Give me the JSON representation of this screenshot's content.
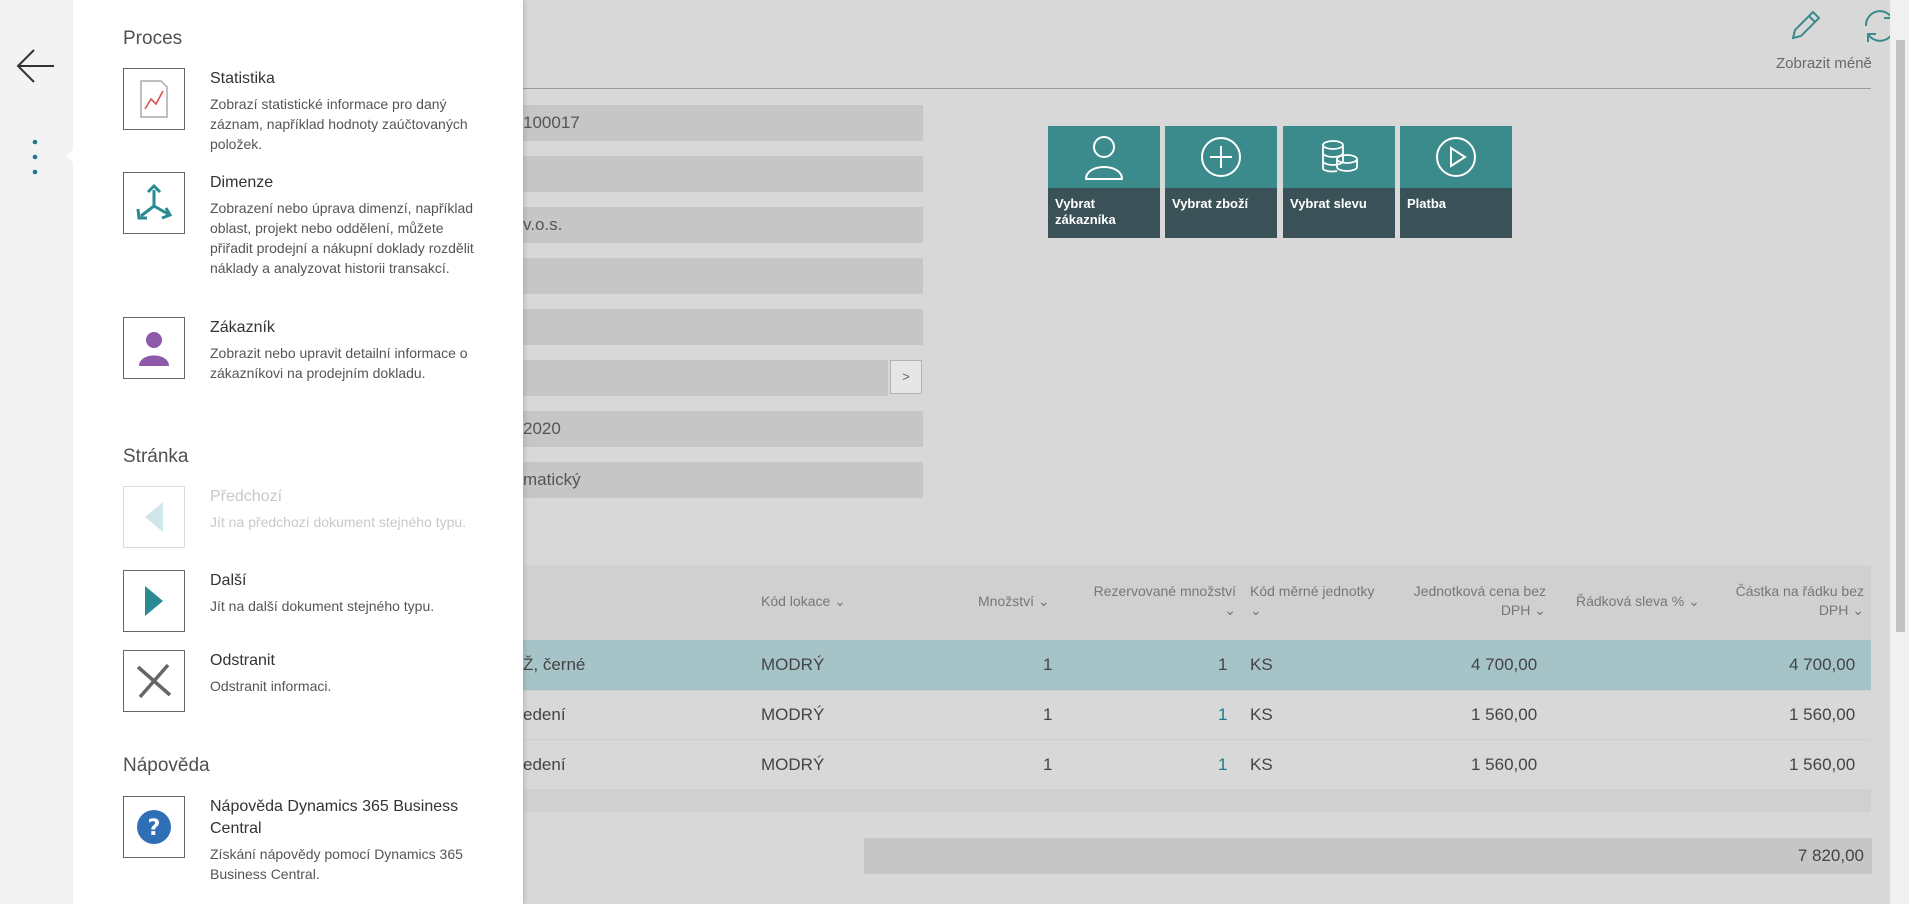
{
  "header": {
    "show_less": "Zobrazit méně"
  },
  "fields": [
    {
      "value": "100017"
    },
    {
      "value": ""
    },
    {
      "value": "v.o.s."
    },
    {
      "value": ""
    },
    {
      "value": ""
    },
    {
      "value": "",
      "button": ">"
    },
    {
      "value": "2020"
    },
    {
      "value": "matický"
    }
  ],
  "tiles": [
    {
      "label": "Vybrat zákazníka",
      "icon": "person-icon"
    },
    {
      "label": "Vybrat zboží",
      "icon": "plus-circle-icon"
    },
    {
      "label": "Vybrat slevu",
      "icon": "coins-icon"
    },
    {
      "label": "Platba",
      "icon": "play-circle-icon"
    }
  ],
  "grid": {
    "columns": {
      "location": "Kód lokace",
      "quantity": "Množství",
      "reserved": "Rezervované množství",
      "uom": "Kód měrné jednotky",
      "unit_price": "Jednotková cena bez DPH",
      "line_discount": "Řádková sleva %",
      "line_amount": "Částka na řádku bez DPH"
    },
    "rows": [
      {
        "desc": "Ž, černé",
        "location": "MODRÝ",
        "quantity": "1",
        "reserved": "1",
        "uom": "KS",
        "unit_price": "4 700,00",
        "line_amount": "4 700,00"
      },
      {
        "desc": "edení",
        "location": "MODRÝ",
        "quantity": "1",
        "reserved": "1",
        "uom": "KS",
        "unit_price": "1 560,00",
        "line_amount": "1 560,00"
      },
      {
        "desc": "edení",
        "location": "MODRÝ",
        "quantity": "1",
        "reserved": "1",
        "uom": "KS",
        "unit_price": "1 560,00",
        "line_amount": "1 560,00"
      }
    ],
    "total": "7 820,00"
  },
  "panel": {
    "process": {
      "title": "Proces",
      "items": [
        {
          "title": "Statistika",
          "desc": "Zobrazí statistické informace pro daný záznam, například hodnoty zaúčtovaných položek."
        },
        {
          "title": "Dimenze",
          "desc": "Zobrazení nebo úprava dimenzí, například oblast, projekt nebo oddělení, můžete přiřadit prodejní a nákupní doklady rozdělit náklady a analyzovat historii transakcí."
        },
        {
          "title": "Zákazník",
          "desc": "Zobrazit nebo upravit detailní informace o zákazníkovi na prodejním dokladu."
        }
      ]
    },
    "page": {
      "title": "Stránka",
      "items": [
        {
          "title": "Předchozí",
          "desc": "Jít na předchozí dokument stejného typu."
        },
        {
          "title": "Další",
          "desc": "Jít na další dokument stejného typu."
        },
        {
          "title": "Odstranit",
          "desc": "Odstranit informaci."
        }
      ]
    },
    "help": {
      "title": "Nápověda",
      "items": [
        {
          "title": "Nápověda Dynamics 365 Business Central",
          "desc": "Získání nápovědy pomocí Dynamics 365 Business Central."
        }
      ]
    }
  },
  "colors": {
    "tile_top": "#3b8a8c",
    "tile_bottom": "#3a5257",
    "selected_row": "#a6c4c7",
    "accent": "#1a7a8c"
  }
}
